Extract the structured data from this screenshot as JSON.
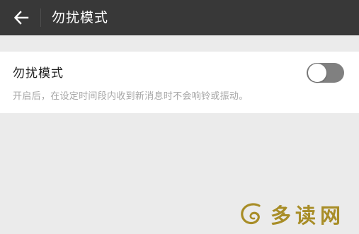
{
  "header": {
    "title": "勿扰模式",
    "back_icon": "arrow-left-icon"
  },
  "setting": {
    "label": "勿扰模式",
    "description": "开启后，在设定时间段内收到新消息时不会响铃或振动。",
    "toggle_state": "off"
  },
  "watermark": {
    "text": "多读网",
    "logo_icon": "swirl-logo-icon"
  },
  "colors": {
    "header_bg": "#383838",
    "page_bg": "#ebebeb",
    "toggle_off": "#808080",
    "watermark": "#a88d27"
  }
}
